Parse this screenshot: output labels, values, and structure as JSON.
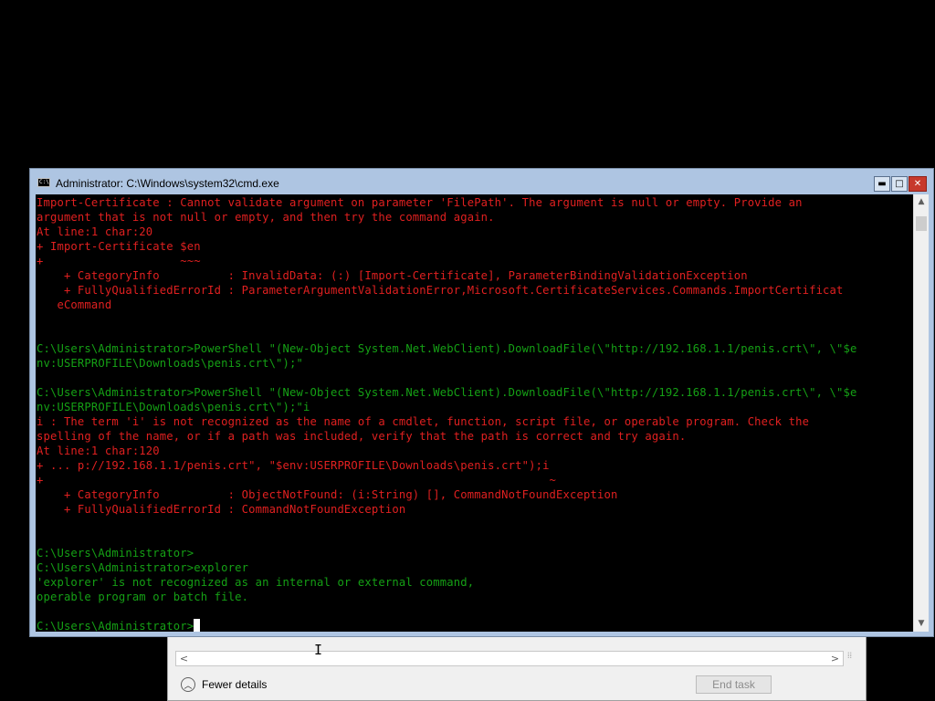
{
  "window": {
    "title": "Administrator: C:\\Windows\\system32\\cmd.exe",
    "icon": "cmd-icon",
    "buttons": {
      "minimize": "▬",
      "maximize": "□",
      "close": "✕"
    }
  },
  "console": {
    "text_color": "#e02020",
    "prompt_color": "#15a015",
    "lines": [
      {
        "text": "Import-Certificate : Cannot validate argument on parameter 'FilePath'. The argument is null or empty. Provide an",
        "color": "red"
      },
      {
        "text": "argument that is not null or empty, and then try the command again.",
        "color": "red"
      },
      {
        "text": "At line:1 char:20",
        "color": "red"
      },
      {
        "text": "+ Import-Certificate $en",
        "color": "red"
      },
      {
        "text": "+                    ~~~",
        "color": "red"
      },
      {
        "text": "    + CategoryInfo          : InvalidData: (:) [Import-Certificate], ParameterBindingValidationException",
        "color": "red"
      },
      {
        "text": "    + FullyQualifiedErrorId : ParameterArgumentValidationError,Microsoft.CertificateServices.Commands.ImportCertificat",
        "color": "red"
      },
      {
        "text": "   eCommand",
        "color": "red"
      },
      {
        "text": "",
        "color": "red"
      },
      {
        "text": "",
        "color": "red"
      },
      {
        "text": "C:\\Users\\Administrator>PowerShell \"(New-Object System.Net.WebClient).DownloadFile(\\\"http://192.168.1.1/penis.crt\\\", \\\"$e",
        "color": "green"
      },
      {
        "text": "nv:USERPROFILE\\Downloads\\penis.crt\\\");\"",
        "color": "green"
      },
      {
        "text": "",
        "color": "green"
      },
      {
        "text": "C:\\Users\\Administrator>PowerShell \"(New-Object System.Net.WebClient).DownloadFile(\\\"http://192.168.1.1/penis.crt\\\", \\\"$e",
        "color": "green"
      },
      {
        "text": "nv:USERPROFILE\\Downloads\\penis.crt\\\");\"i",
        "color": "green"
      },
      {
        "text": "i : The term 'i' is not recognized as the name of a cmdlet, function, script file, or operable program. Check the",
        "color": "red"
      },
      {
        "text": "spelling of the name, or if a path was included, verify that the path is correct and try again.",
        "color": "red"
      },
      {
        "text": "At line:1 char:120",
        "color": "red"
      },
      {
        "text": "+ ... p://192.168.1.1/penis.crt\", \"$env:USERPROFILE\\Downloads\\penis.crt\");i",
        "color": "red"
      },
      {
        "text": "+                                                                          ~",
        "color": "red"
      },
      {
        "text": "    + CategoryInfo          : ObjectNotFound: (i:String) [], CommandNotFoundException",
        "color": "red"
      },
      {
        "text": "    + FullyQualifiedErrorId : CommandNotFoundException",
        "color": "red"
      },
      {
        "text": "",
        "color": "green"
      },
      {
        "text": "",
        "color": "green"
      },
      {
        "text": "C:\\Users\\Administrator>",
        "color": "green"
      },
      {
        "text": "C:\\Users\\Administrator>explorer",
        "color": "green"
      },
      {
        "text": "'explorer' is not recognized as an internal or external command,",
        "color": "green"
      },
      {
        "text": "operable program or batch file.",
        "color": "green"
      },
      {
        "text": "",
        "color": "green"
      },
      {
        "text": "C:\\Users\\Administrator>",
        "color": "green",
        "cursor": true
      }
    ]
  },
  "taskmgr": {
    "fewer_details": "Fewer details",
    "end_task": "End task",
    "scroll_left": "<",
    "scroll_right": ">"
  }
}
